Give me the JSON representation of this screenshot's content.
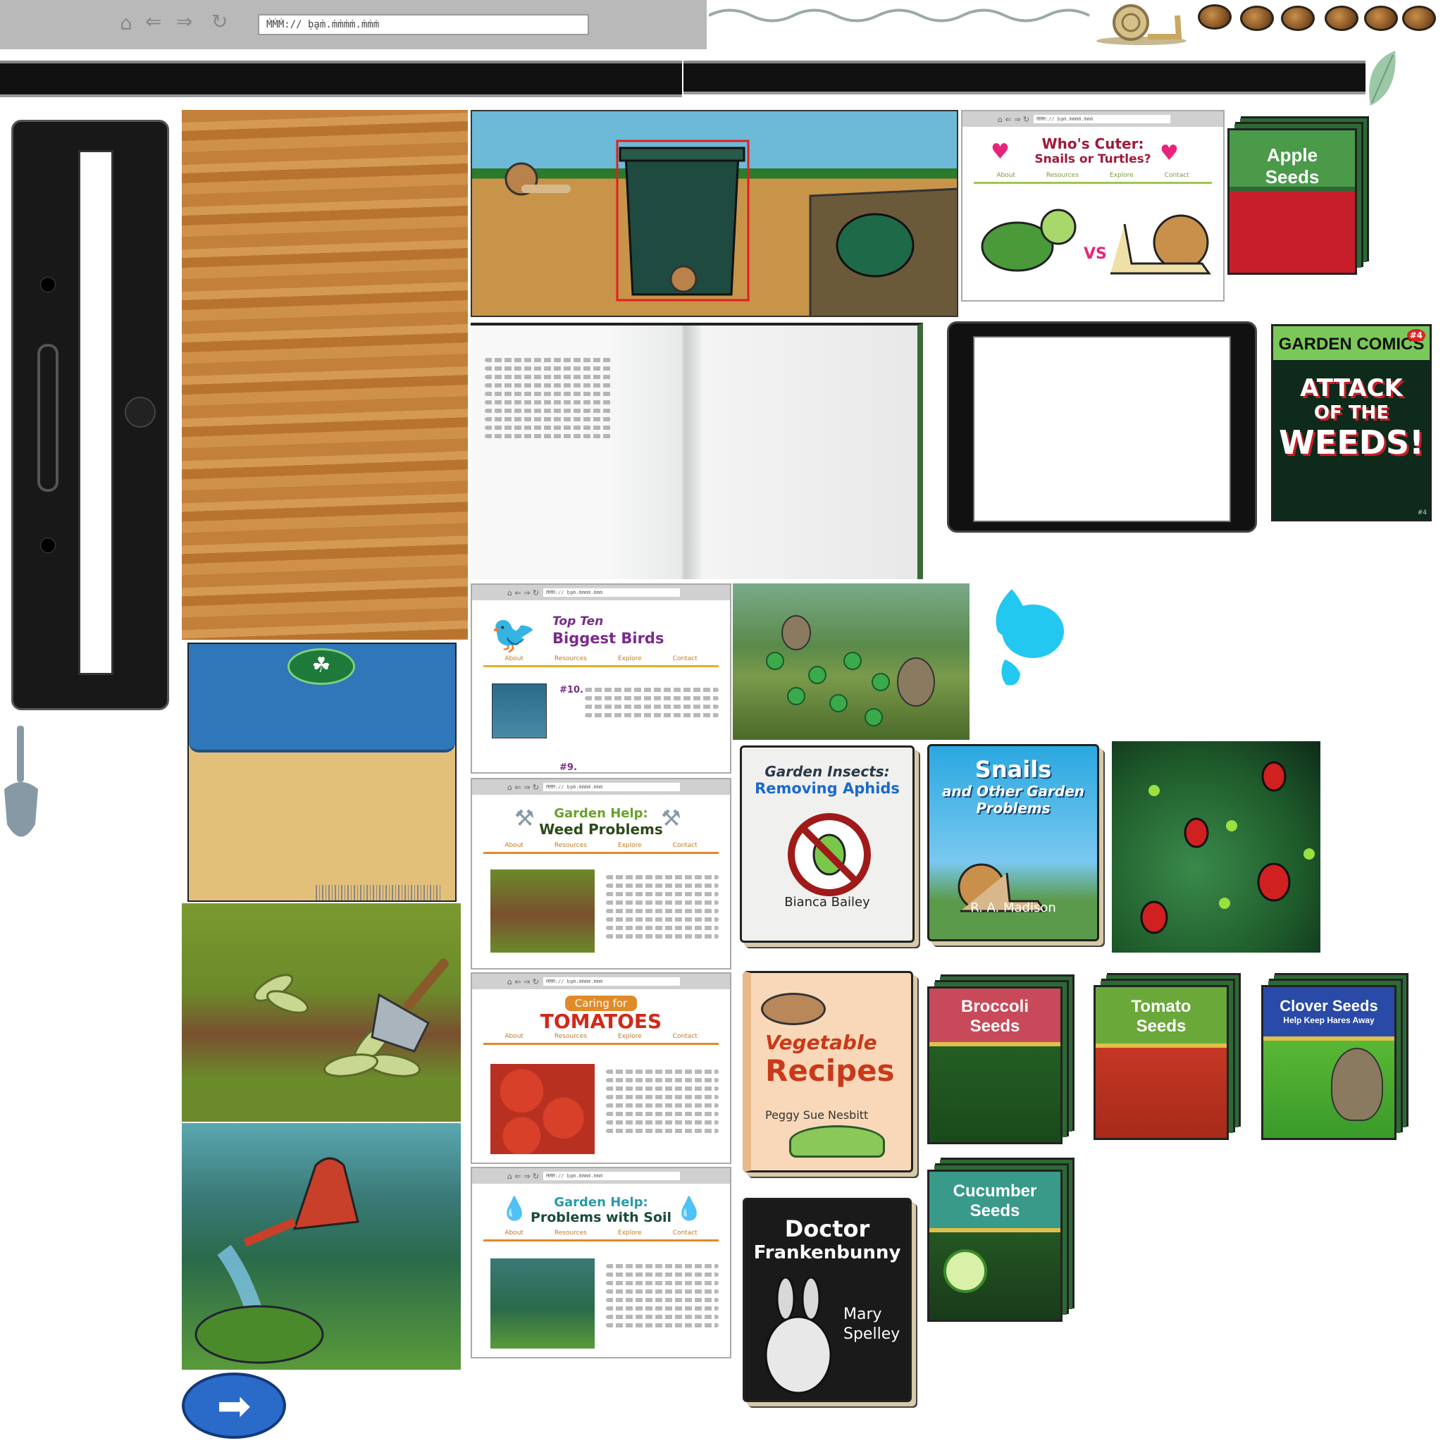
{
  "browser": {
    "url": "ḾḾḾ:// ḅḁṁ.ṁṁṁṁ.ṁṁṁ",
    "home_icon": "home-icon",
    "back_icon": "arrow-left-icon",
    "forward_icon": "arrow-right-icon",
    "reload_icon": "reload-icon"
  },
  "snail_site": {
    "title_line1": "Who's Cuter:",
    "title_line2": "Snails or Turtles?",
    "vs": "VS",
    "nav": [
      "About",
      "Resources",
      "Explore",
      "Contact"
    ]
  },
  "birds_site": {
    "title_line1": "Top Ten",
    "title_line2": "Biggest Birds",
    "nav": [
      "About",
      "Resources",
      "Explore",
      "Contact"
    ],
    "item1": "#10.",
    "item2": "#9."
  },
  "weeds_site": {
    "title_line1": "Garden Help:",
    "title_line2": "Weed Problems",
    "nav": [
      "About",
      "Resources",
      "Explore",
      "Contact"
    ]
  },
  "tomato_site": {
    "title_line1": "Caring for",
    "title_line2": "TOMATOES",
    "nav": [
      "About",
      "Resources",
      "Explore",
      "Contact"
    ]
  },
  "soil_site": {
    "title_line1": "Garden Help:",
    "title_line2": "Problems with Soil",
    "nav": [
      "About",
      "Resources",
      "Explore",
      "Contact"
    ]
  },
  "books": {
    "aphids": {
      "title1": "Garden Insects:",
      "title2": "Removing Aphids",
      "author": "Bianca Bailey"
    },
    "snails": {
      "title1": "Snails",
      "title2": "and Other Garden",
      "title3": "Problems",
      "author": "R. A. Madison"
    },
    "recipes": {
      "title1": "Vegetable",
      "title2": "Recipes",
      "author": "Peggy Sue Nesbitt"
    },
    "franken": {
      "title1": "Doctor",
      "title2": "Frankenbunny",
      "author1": "Mary",
      "author2": "Spelley"
    }
  },
  "comic": {
    "title": "GARDEN COMICS",
    "issue": "#4",
    "line1": "ATTACK",
    "line2": "OF THE",
    "line3": "WEEDS!",
    "corner": "#4"
  },
  "packets": {
    "apple": {
      "line1": "Apple",
      "line2": "Seeds"
    },
    "broccoli": {
      "line1": "Broccoli",
      "line2": "Seeds"
    },
    "tomato": {
      "line1": "Tomato",
      "line2": "Seeds"
    },
    "clover": {
      "line1": "Clover Seeds",
      "line2": "Help Keep Hares Away"
    },
    "cucumber": {
      "line1": "Cucumber",
      "line2": "Seeds"
    }
  },
  "next_icon": "arrow-right-icon",
  "colors": {
    "black_bar": "#111111",
    "browser_gray": "#b9b9b9",
    "wood": "#c8883e",
    "folder_blue": "#2f77b8",
    "pink": "#e8247a",
    "purple": "#7a2a8a",
    "orange": "#e08a2a",
    "green": "#2c6a34"
  }
}
